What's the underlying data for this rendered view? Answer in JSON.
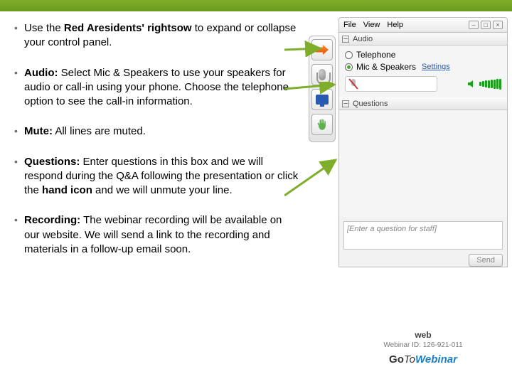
{
  "instructions": {
    "redArrow": {
      "pre": "Use the ",
      "bold": "Red Aresidents' rightsow",
      "post": " to expand or collapse your control panel."
    },
    "audio": {
      "bold": "Audio:",
      "text": " Select Mic & Speakers to use your speakers for audio or call-in using your phone. Choose the telephone option to see the call-in information."
    },
    "mute": {
      "bold": "Mute:",
      "text": " All lines are muted."
    },
    "questions": {
      "bold": "Questions:",
      "text1": " Enter questions in this box and we will respond during the Q&A following the presentation or click the ",
      "bold2": "hand icon",
      "text2": " and we will unmute your line."
    },
    "recording": {
      "bold": "Recording:",
      "text": " The webinar recording will be available on our website. We will send a link to the recording and materials in a follow-up email soon."
    }
  },
  "panel": {
    "menu": {
      "file": "File",
      "view": "View",
      "help": "Help"
    },
    "sections": {
      "audio": "Audio",
      "questions": "Questions"
    },
    "audio": {
      "telephone": "Telephone",
      "micSpeakers": "Mic & Speakers",
      "settings": "Settings"
    },
    "questions": {
      "placeholder": "[Enter a question for staff]",
      "send": "Send"
    },
    "footer": {
      "name": "web",
      "id": "Webinar ID: 126-921-011",
      "brand_go": "Go",
      "brand_to": "To",
      "brand_w": "Webinar"
    }
  }
}
